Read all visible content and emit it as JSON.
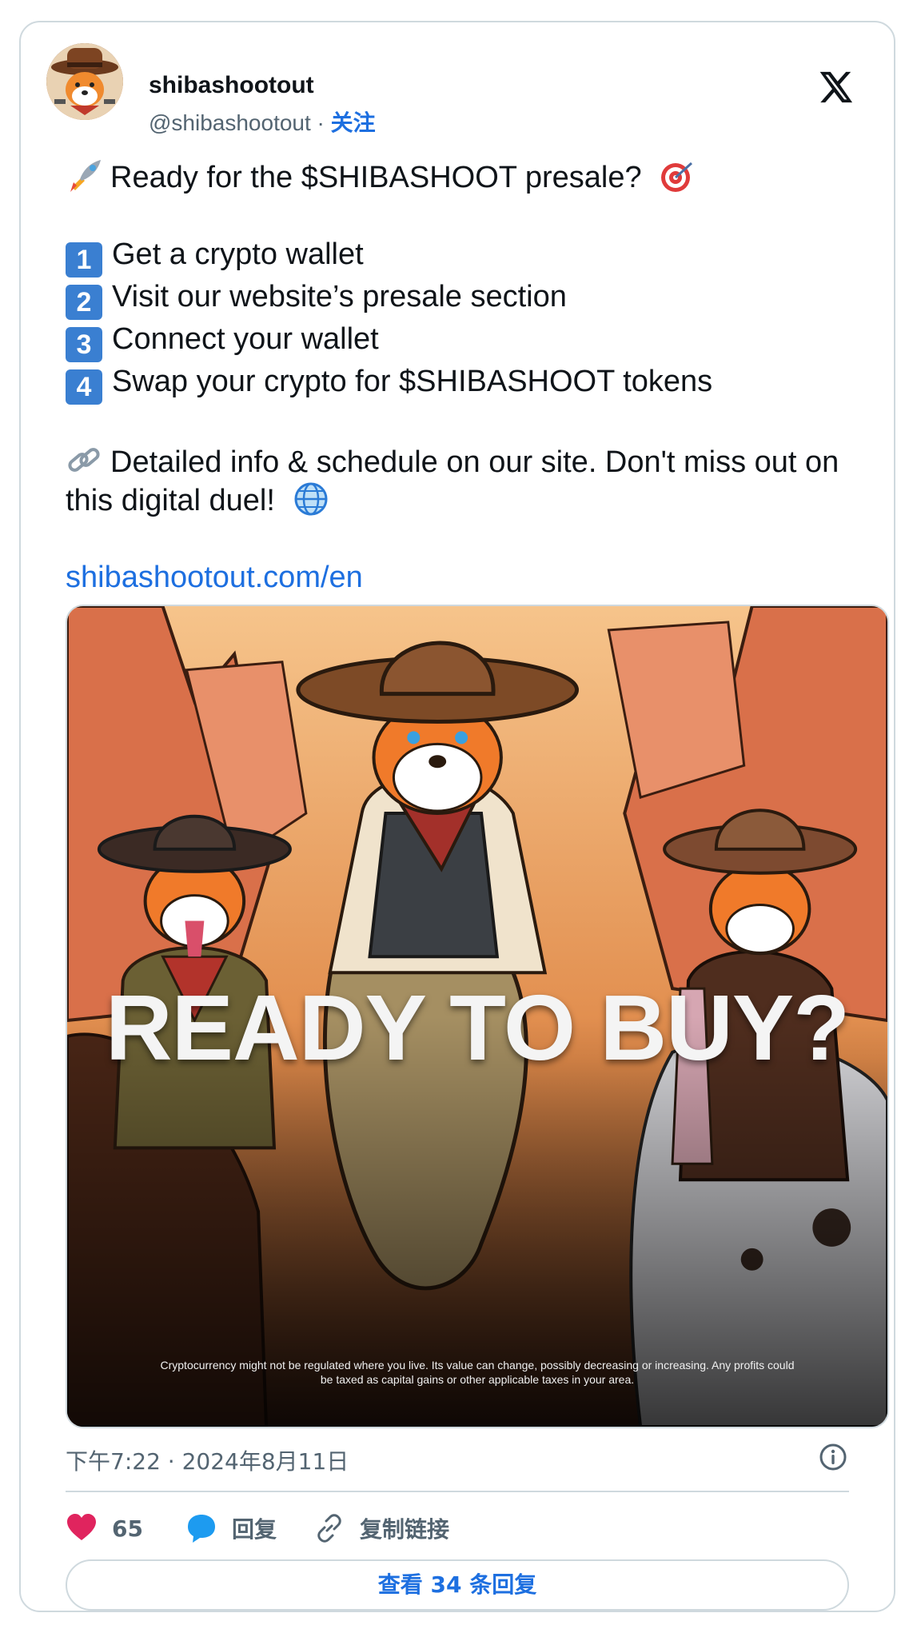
{
  "user": {
    "name": "shibashootout",
    "handle": "@shibashootout",
    "separator": " · ",
    "follow_label": "关注"
  },
  "tweet": {
    "line1": "Ready for the $SHIBASHOOT presale?",
    "steps": [
      {
        "num": "1",
        "text": "Get a crypto wallet"
      },
      {
        "num": "2",
        "text": "Visit our website’s presale section"
      },
      {
        "num": "3",
        "text": "Connect your wallet"
      },
      {
        "num": "4",
        "text": "Swap your crypto for $SHIBASHOOT tokens"
      }
    ],
    "info": "Detailed info & schedule on our site. Don't miss out on this digital duel!",
    "link": "shibashootout.com/en"
  },
  "media": {
    "headline": "READY TO BUY?",
    "disclaimer": "Cryptocurrency might not be regulated where you live. Its value can change, possibly decreasing or increasing. Any profits could be taxed as capital gains or other applicable taxes in your area."
  },
  "timestamp": "下午7:22 · 2024年8月11日",
  "actions": {
    "likes_count": "65",
    "reply_label": "回复",
    "copy_link_label": "复制链接"
  },
  "replies_button": "查看 34 条回复",
  "colors": {
    "link": "#1d6fe0",
    "like": "#e0245e",
    "reply": "#1d9bf0",
    "border": "#cfd9de",
    "muted": "#536471"
  }
}
